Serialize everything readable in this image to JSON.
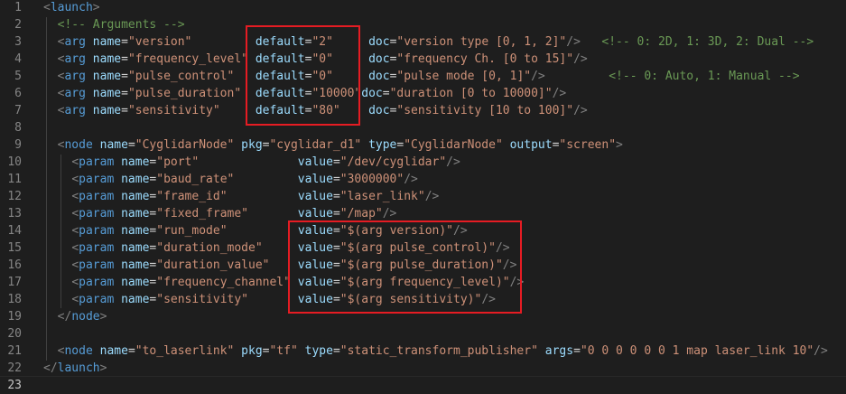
{
  "editor": {
    "colors": {
      "background": "#1e1e1e",
      "tag": "#569cd6",
      "attr": "#9cdcfe",
      "string": "#ce9178",
      "comment": "#6a9955",
      "punct": "#808080",
      "line_number": "#858585",
      "highlight_box": "#e51c23"
    },
    "current_line": 23,
    "lines": [
      {
        "n": "1",
        "tokens": [
          [
            "p",
            "<"
          ],
          [
            "g",
            "launch"
          ],
          [
            "p",
            ">"
          ]
        ]
      },
      {
        "n": "2",
        "tokens": [
          [
            "w",
            "  "
          ],
          [
            "c",
            "<!-- Arguments -->"
          ]
        ]
      },
      {
        "n": "3",
        "tokens": [
          [
            "w",
            "  "
          ],
          [
            "p",
            "<"
          ],
          [
            "g",
            "arg"
          ],
          [
            "w",
            " "
          ],
          [
            "a",
            "name"
          ],
          [
            "e",
            "="
          ],
          [
            "s",
            "\"version\""
          ],
          [
            "w",
            "         "
          ],
          [
            "a",
            "default"
          ],
          [
            "e",
            "="
          ],
          [
            "s",
            "\"2\""
          ],
          [
            "w",
            "     "
          ],
          [
            "a",
            "doc"
          ],
          [
            "e",
            "="
          ],
          [
            "s",
            "\"version type [0, 1, 2]\""
          ],
          [
            "p",
            "/>"
          ],
          [
            "w",
            "   "
          ],
          [
            "c",
            "<!-- 0: 2D, 1: 3D, 2: Dual -->"
          ]
        ]
      },
      {
        "n": "4",
        "tokens": [
          [
            "w",
            "  "
          ],
          [
            "p",
            "<"
          ],
          [
            "g",
            "arg"
          ],
          [
            "w",
            " "
          ],
          [
            "a",
            "name"
          ],
          [
            "e",
            "="
          ],
          [
            "s",
            "\"frequency_level\""
          ],
          [
            "w",
            " "
          ],
          [
            "a",
            "default"
          ],
          [
            "e",
            "="
          ],
          [
            "s",
            "\"0\""
          ],
          [
            "w",
            "     "
          ],
          [
            "a",
            "doc"
          ],
          [
            "e",
            "="
          ],
          [
            "s",
            "\"frequency Ch. [0 to 15]\""
          ],
          [
            "p",
            "/>"
          ]
        ]
      },
      {
        "n": "5",
        "tokens": [
          [
            "w",
            "  "
          ],
          [
            "p",
            "<"
          ],
          [
            "g",
            "arg"
          ],
          [
            "w",
            " "
          ],
          [
            "a",
            "name"
          ],
          [
            "e",
            "="
          ],
          [
            "s",
            "\"pulse_control\""
          ],
          [
            "w",
            "   "
          ],
          [
            "a",
            "default"
          ],
          [
            "e",
            "="
          ],
          [
            "s",
            "\"0\""
          ],
          [
            "w",
            "     "
          ],
          [
            "a",
            "doc"
          ],
          [
            "e",
            "="
          ],
          [
            "s",
            "\"pulse mode [0, 1]\""
          ],
          [
            "p",
            "/>"
          ],
          [
            "w",
            "         "
          ],
          [
            "c",
            "<!-- 0: Auto, 1: Manual -->"
          ]
        ]
      },
      {
        "n": "6",
        "tokens": [
          [
            "w",
            "  "
          ],
          [
            "p",
            "<"
          ],
          [
            "g",
            "arg"
          ],
          [
            "w",
            " "
          ],
          [
            "a",
            "name"
          ],
          [
            "e",
            "="
          ],
          [
            "s",
            "\"pulse_duration\""
          ],
          [
            "w",
            "  "
          ],
          [
            "a",
            "default"
          ],
          [
            "e",
            "="
          ],
          [
            "s",
            "\"10000\""
          ],
          [
            "a",
            "doc"
          ],
          [
            "e",
            "="
          ],
          [
            "s",
            "\"duration [0 to 10000]\""
          ],
          [
            "p",
            "/>"
          ]
        ]
      },
      {
        "n": "7",
        "tokens": [
          [
            "w",
            "  "
          ],
          [
            "p",
            "<"
          ],
          [
            "g",
            "arg"
          ],
          [
            "w",
            " "
          ],
          [
            "a",
            "name"
          ],
          [
            "e",
            "="
          ],
          [
            "s",
            "\"sensitivity\""
          ],
          [
            "w",
            "     "
          ],
          [
            "a",
            "default"
          ],
          [
            "e",
            "="
          ],
          [
            "s",
            "\"80\""
          ],
          [
            "w",
            "    "
          ],
          [
            "a",
            "doc"
          ],
          [
            "e",
            "="
          ],
          [
            "s",
            "\"sensitivity [10 to 100]\""
          ],
          [
            "p",
            "/>"
          ]
        ]
      },
      {
        "n": "8",
        "tokens": []
      },
      {
        "n": "9",
        "tokens": [
          [
            "w",
            "  "
          ],
          [
            "p",
            "<"
          ],
          [
            "g",
            "node"
          ],
          [
            "w",
            " "
          ],
          [
            "a",
            "name"
          ],
          [
            "e",
            "="
          ],
          [
            "s",
            "\"CyglidarNode\""
          ],
          [
            "w",
            " "
          ],
          [
            "a",
            "pkg"
          ],
          [
            "e",
            "="
          ],
          [
            "s",
            "\"cyglidar_d1\""
          ],
          [
            "w",
            " "
          ],
          [
            "a",
            "type"
          ],
          [
            "e",
            "="
          ],
          [
            "s",
            "\"CyglidarNode\""
          ],
          [
            "w",
            " "
          ],
          [
            "a",
            "output"
          ],
          [
            "e",
            "="
          ],
          [
            "s",
            "\"screen\""
          ],
          [
            "p",
            ">"
          ]
        ]
      },
      {
        "n": "10",
        "tokens": [
          [
            "w",
            "    "
          ],
          [
            "p",
            "<"
          ],
          [
            "g",
            "param"
          ],
          [
            "w",
            " "
          ],
          [
            "a",
            "name"
          ],
          [
            "e",
            "="
          ],
          [
            "s",
            "\"port\""
          ],
          [
            "w",
            "              "
          ],
          [
            "a",
            "value"
          ],
          [
            "e",
            "="
          ],
          [
            "s",
            "\"/dev/cyglidar\""
          ],
          [
            "p",
            "/>"
          ]
        ]
      },
      {
        "n": "11",
        "tokens": [
          [
            "w",
            "    "
          ],
          [
            "p",
            "<"
          ],
          [
            "g",
            "param"
          ],
          [
            "w",
            " "
          ],
          [
            "a",
            "name"
          ],
          [
            "e",
            "="
          ],
          [
            "s",
            "\"baud_rate\""
          ],
          [
            "w",
            "         "
          ],
          [
            "a",
            "value"
          ],
          [
            "e",
            "="
          ],
          [
            "s",
            "\"3000000\""
          ],
          [
            "p",
            "/>"
          ]
        ]
      },
      {
        "n": "12",
        "tokens": [
          [
            "w",
            "    "
          ],
          [
            "p",
            "<"
          ],
          [
            "g",
            "param"
          ],
          [
            "w",
            " "
          ],
          [
            "a",
            "name"
          ],
          [
            "e",
            "="
          ],
          [
            "s",
            "\"frame_id\""
          ],
          [
            "w",
            "          "
          ],
          [
            "a",
            "value"
          ],
          [
            "e",
            "="
          ],
          [
            "s",
            "\"laser_link\""
          ],
          [
            "p",
            "/>"
          ]
        ]
      },
      {
        "n": "13",
        "tokens": [
          [
            "w",
            "    "
          ],
          [
            "p",
            "<"
          ],
          [
            "g",
            "param"
          ],
          [
            "w",
            " "
          ],
          [
            "a",
            "name"
          ],
          [
            "e",
            "="
          ],
          [
            "s",
            "\"fixed_frame\""
          ],
          [
            "w",
            "       "
          ],
          [
            "a",
            "value"
          ],
          [
            "e",
            "="
          ],
          [
            "s",
            "\"/map\""
          ],
          [
            "p",
            "/>"
          ]
        ]
      },
      {
        "n": "14",
        "tokens": [
          [
            "w",
            "    "
          ],
          [
            "p",
            "<"
          ],
          [
            "g",
            "param"
          ],
          [
            "w",
            " "
          ],
          [
            "a",
            "name"
          ],
          [
            "e",
            "="
          ],
          [
            "s",
            "\"run_mode\""
          ],
          [
            "w",
            "          "
          ],
          [
            "a",
            "value"
          ],
          [
            "e",
            "="
          ],
          [
            "s",
            "\"$(arg version)\""
          ],
          [
            "p",
            "/>"
          ]
        ]
      },
      {
        "n": "15",
        "tokens": [
          [
            "w",
            "    "
          ],
          [
            "p",
            "<"
          ],
          [
            "g",
            "param"
          ],
          [
            "w",
            " "
          ],
          [
            "a",
            "name"
          ],
          [
            "e",
            "="
          ],
          [
            "s",
            "\"duration_mode\""
          ],
          [
            "w",
            "     "
          ],
          [
            "a",
            "value"
          ],
          [
            "e",
            "="
          ],
          [
            "s",
            "\"$(arg pulse_control)\""
          ],
          [
            "p",
            "/>"
          ]
        ]
      },
      {
        "n": "16",
        "tokens": [
          [
            "w",
            "    "
          ],
          [
            "p",
            "<"
          ],
          [
            "g",
            "param"
          ],
          [
            "w",
            " "
          ],
          [
            "a",
            "name"
          ],
          [
            "e",
            "="
          ],
          [
            "s",
            "\"duration_value\""
          ],
          [
            "w",
            "    "
          ],
          [
            "a",
            "value"
          ],
          [
            "e",
            "="
          ],
          [
            "s",
            "\"$(arg pulse_duration)\""
          ],
          [
            "p",
            "/>"
          ]
        ]
      },
      {
        "n": "17",
        "tokens": [
          [
            "w",
            "    "
          ],
          [
            "p",
            "<"
          ],
          [
            "g",
            "param"
          ],
          [
            "w",
            " "
          ],
          [
            "a",
            "name"
          ],
          [
            "e",
            "="
          ],
          [
            "s",
            "\"frequency_channel\""
          ],
          [
            "w",
            " "
          ],
          [
            "a",
            "value"
          ],
          [
            "e",
            "="
          ],
          [
            "s",
            "\"$(arg frequency_level)\""
          ],
          [
            "p",
            "/>"
          ]
        ]
      },
      {
        "n": "18",
        "tokens": [
          [
            "w",
            "    "
          ],
          [
            "p",
            "<"
          ],
          [
            "g",
            "param"
          ],
          [
            "w",
            " "
          ],
          [
            "a",
            "name"
          ],
          [
            "e",
            "="
          ],
          [
            "s",
            "\"sensitivity\""
          ],
          [
            "w",
            "       "
          ],
          [
            "a",
            "value"
          ],
          [
            "e",
            "="
          ],
          [
            "s",
            "\"$(arg sensitivity)\""
          ],
          [
            "p",
            "/>"
          ]
        ]
      },
      {
        "n": "19",
        "tokens": [
          [
            "w",
            "  "
          ],
          [
            "p",
            "</"
          ],
          [
            "g",
            "node"
          ],
          [
            "p",
            ">"
          ]
        ]
      },
      {
        "n": "20",
        "tokens": []
      },
      {
        "n": "21",
        "tokens": [
          [
            "w",
            "  "
          ],
          [
            "p",
            "<"
          ],
          [
            "g",
            "node"
          ],
          [
            "w",
            " "
          ],
          [
            "a",
            "name"
          ],
          [
            "e",
            "="
          ],
          [
            "s",
            "\"to_laserlink\""
          ],
          [
            "w",
            " "
          ],
          [
            "a",
            "pkg"
          ],
          [
            "e",
            "="
          ],
          [
            "s",
            "\"tf\""
          ],
          [
            "w",
            " "
          ],
          [
            "a",
            "type"
          ],
          [
            "e",
            "="
          ],
          [
            "s",
            "\"static_transform_publisher\""
          ],
          [
            "w",
            " "
          ],
          [
            "a",
            "args"
          ],
          [
            "e",
            "="
          ],
          [
            "s",
            "\"0 0 0 0 0 0 1 map laser_link 10\""
          ],
          [
            "p",
            "/>"
          ]
        ]
      },
      {
        "n": "22",
        "tokens": [
          [
            "p",
            "</"
          ],
          [
            "g",
            "launch"
          ],
          [
            "p",
            ">"
          ]
        ]
      },
      {
        "n": "23",
        "tokens": []
      }
    ]
  }
}
